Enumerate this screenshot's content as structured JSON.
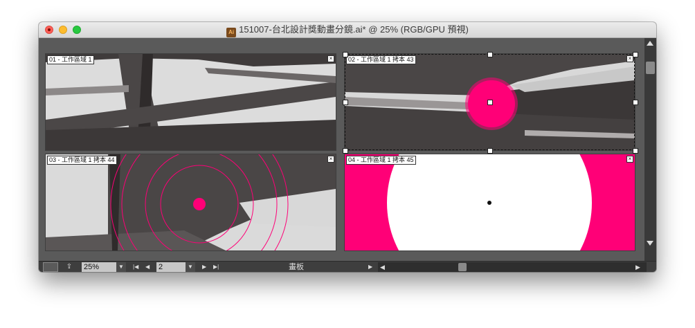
{
  "window": {
    "title": "151007-台北設計獎動畫分鏡.ai* @ 25% (RGB/GPU 預視)",
    "file_icon": "ai-file-icon",
    "file_icon_text": "Ai"
  },
  "artboards": [
    {
      "label": "01 - 工作區域 1"
    },
    {
      "label": "02 - 工作區域 1 拷本 43"
    },
    {
      "label": "03 - 工作區域 1 拷本 44"
    },
    {
      "label": "04 - 工作區域 1 拷本 45"
    }
  ],
  "close_glyph": "×",
  "statusbar": {
    "zoom": "25%",
    "page": "2",
    "status_text": "畫板",
    "dropdown_glyph": "▼",
    "first_glyph": "|◀",
    "prev_glyph": "◀",
    "next_glyph": "▶",
    "last_glyph": "▶|",
    "status_arrow": "▶",
    "scroll_left": "◀",
    "scroll_right": "▶"
  },
  "colors": {
    "accent_pink": "#ff0077",
    "canvas_bg": "#5a5a5a"
  }
}
